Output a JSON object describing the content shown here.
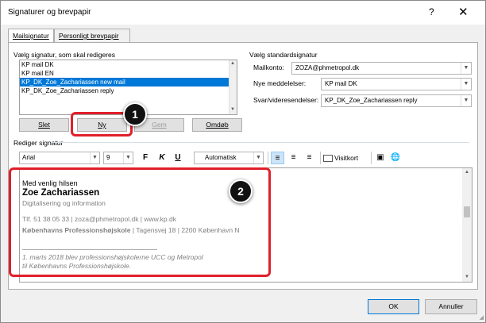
{
  "window": {
    "title": "Signaturer og brevpapir",
    "help": "?",
    "close": "✕"
  },
  "tabs": [
    {
      "label": "Mailsignatur",
      "active": true
    },
    {
      "label": "Personligt brevpapir",
      "active": false
    }
  ],
  "select_signature": {
    "label": "Vælg signatur, som skal redigeres",
    "items": [
      {
        "label": "KP mail DK",
        "selected": false
      },
      {
        "label": "KP mail EN",
        "selected": false
      },
      {
        "label": "KP_DK_Zoe_Zachariassen new mail",
        "selected": true
      },
      {
        "label": "KP_DK_Zoe_Zachariassen reply",
        "selected": false
      }
    ],
    "buttons": {
      "delete": "Slet",
      "new": "Ny",
      "save": "Gem",
      "rename": "Omdøb"
    }
  },
  "defaults": {
    "label": "Vælg standardsignatur",
    "account_label": "Mailkonto:",
    "account_value": "ZOZA@phmetropol.dk",
    "new_messages_label": "Nye meddelelser:",
    "new_messages_value": "KP mail DK",
    "replies_label": "Svar/videresendelser:",
    "replies_value": "KP_DK_Zoe_Zachariassen reply"
  },
  "edit_signature": {
    "label": "Rediger signatur",
    "font": "Arial",
    "size": "9",
    "bold": "F",
    "italic": "K",
    "underline": "U",
    "color": "Automatisk",
    "business_card": "Visitkort"
  },
  "signature_body": {
    "greeting": "Med venlig hilsen",
    "name": "Zoe Zachariassen",
    "department": "Digitalisering og information",
    "contact": "Tlf. 51 38 05 33 | zoza@phmetropol.dk | www.kp.dk",
    "org": "Københavns Professionshøjskole",
    "address": " | Tagensvej 18 | 2200 København N",
    "note_line1": "1. marts 2018 blev professionshøjskolerne UCC og Metropol",
    "note_line2": "til Københavns Professionshøjskole."
  },
  "callouts": {
    "marker1": "1",
    "marker2": "2"
  },
  "footer": {
    "ok": "OK",
    "cancel": "Annuller"
  },
  "colors": {
    "selection": "#0078d7",
    "callout": "#e0202a",
    "muted_text": "#808080"
  }
}
